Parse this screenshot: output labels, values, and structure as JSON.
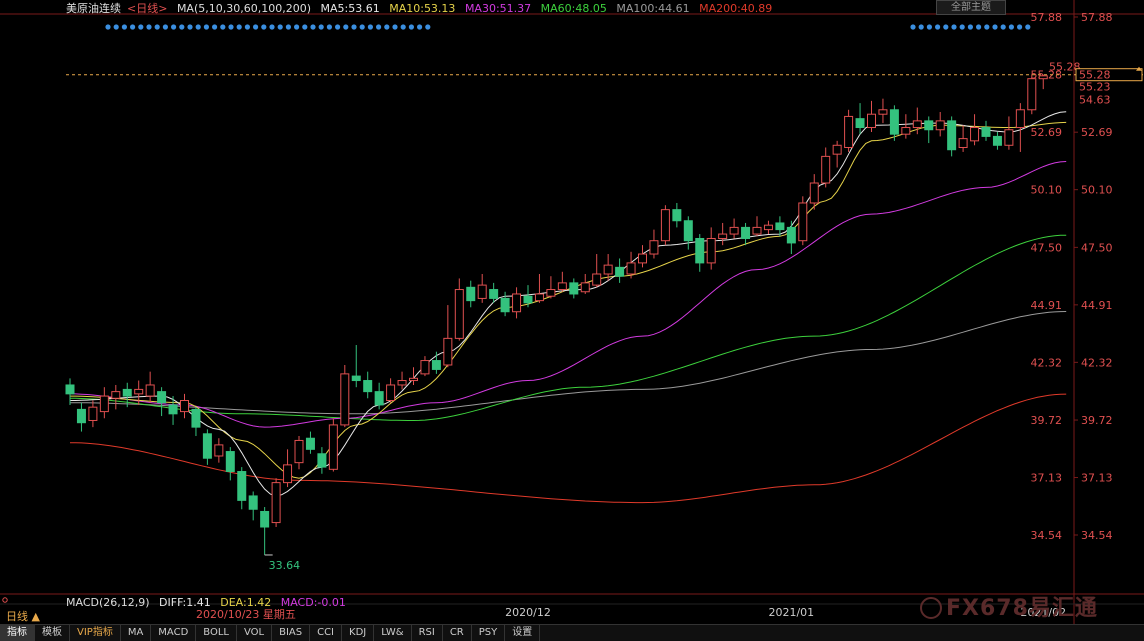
{
  "header": {
    "instrument": "美原油连续",
    "period_tag": "<日线>",
    "ma_params": "MA(5,10,30,60,100,200)",
    "ma5": "MA5:53.61",
    "ma10": "MA10:53.13",
    "ma30": "MA30:51.37",
    "ma60": "MA60:48.05",
    "ma100": "MA100:44.61",
    "ma200": "MA200:40.89",
    "theme_button": "全部主题"
  },
  "indicator": {
    "period_label": "日线 ▲",
    "macd_params": "MACD(26,12,9)",
    "diff": "DIFF:1.41",
    "dea": "DEA:1.42",
    "macd": "MACD:-0.01",
    "date_flag": "2020/10/23 星期五"
  },
  "watermark": "FX678易汇通",
  "toolbar": {
    "items": [
      "指标",
      "模板",
      "VIP指标",
      "MA",
      "MACD",
      "BOLL",
      "VOL",
      "BIAS",
      "CCI",
      "KDJ",
      "LW&",
      "RSI",
      "CR",
      "PSY",
      "设置"
    ]
  },
  "chart_data": {
    "type": "candlestick",
    "y_ticks": [
      "57.88",
      "55.28",
      "52.69",
      "50.10",
      "47.50",
      "44.91",
      "42.32",
      "39.72",
      "37.13",
      "34.54"
    ],
    "ylim": [
      32.0,
      59.0
    ],
    "x_ticks": [
      "2020/12",
      "2021/01",
      "2021/02"
    ],
    "annotations": {
      "high_label": "55.28",
      "low_label": "33.64",
      "price_box": [
        "55.28",
        "55.23",
        "54.63"
      ]
    },
    "colors": {
      "up": "#e05050",
      "down": "#34c27e",
      "ma5": "#e8e8e8",
      "ma10": "#e6d34a",
      "ma30": "#d23be0",
      "ma60": "#3dd13d",
      "ma100": "#9a9a9a",
      "ma200": "#e03a2a",
      "bg": "#000000",
      "axis": "#7a1a1a",
      "tick_text": "#e05050"
    },
    "candles": [
      [
        41.3,
        40.9,
        41.6,
        40.4
      ],
      [
        40.2,
        39.6,
        40.5,
        39.2
      ],
      [
        39.7,
        40.3,
        40.6,
        39.4
      ],
      [
        40.1,
        40.8,
        41.2,
        39.8
      ],
      [
        40.7,
        41.0,
        41.3,
        40.2
      ],
      [
        41.1,
        40.8,
        41.4,
        40.3
      ],
      [
        40.9,
        41.1,
        41.5,
        40.4
      ],
      [
        40.8,
        41.3,
        41.9,
        40.5
      ],
      [
        41.0,
        40.5,
        41.2,
        39.9
      ],
      [
        40.4,
        40.0,
        40.8,
        39.5
      ],
      [
        40.1,
        40.6,
        40.9,
        39.8
      ],
      [
        40.2,
        39.4,
        40.3,
        39.0
      ],
      [
        39.1,
        38.0,
        39.3,
        37.7
      ],
      [
        38.1,
        38.6,
        38.9,
        37.8
      ],
      [
        38.3,
        37.4,
        38.5,
        37.0
      ],
      [
        37.4,
        36.1,
        37.6,
        35.7
      ],
      [
        36.3,
        35.7,
        36.5,
        35.2
      ],
      [
        35.6,
        34.9,
        35.8,
        33.64
      ],
      [
        35.1,
        36.9,
        37.1,
        34.9
      ],
      [
        36.9,
        37.7,
        38.4,
        36.7
      ],
      [
        37.8,
        38.8,
        39.0,
        37.5
      ],
      [
        38.9,
        38.4,
        39.2,
        38.2
      ],
      [
        38.2,
        37.6,
        38.5,
        37.3
      ],
      [
        37.5,
        39.5,
        39.8,
        37.4
      ],
      [
        39.5,
        41.8,
        42.2,
        39.4
      ],
      [
        41.7,
        41.5,
        43.1,
        41.2
      ],
      [
        41.5,
        41.0,
        41.9,
        40.7
      ],
      [
        41.0,
        40.4,
        41.4,
        40.2
      ],
      [
        40.6,
        41.3,
        41.6,
        40.5
      ],
      [
        41.3,
        41.5,
        41.9,
        41.1
      ],
      [
        41.5,
        41.6,
        42.1,
        41.3
      ],
      [
        41.8,
        42.4,
        42.6,
        41.7
      ],
      [
        42.4,
        42.0,
        42.8,
        41.8
      ],
      [
        42.2,
        43.4,
        44.9,
        42.1
      ],
      [
        43.4,
        45.6,
        46.1,
        43.3
      ],
      [
        45.7,
        45.1,
        46.0,
        44.8
      ],
      [
        45.2,
        45.8,
        46.3,
        45.0
      ],
      [
        45.6,
        45.2,
        45.9,
        45.0
      ],
      [
        45.2,
        44.6,
        45.5,
        44.4
      ],
      [
        44.6,
        45.4,
        45.7,
        44.3
      ],
      [
        45.3,
        45.0,
        45.8,
        44.8
      ],
      [
        45.1,
        45.4,
        46.3,
        45.0
      ],
      [
        45.3,
        45.6,
        46.2,
        45.2
      ],
      [
        45.6,
        45.9,
        46.4,
        45.5
      ],
      [
        45.9,
        45.4,
        46.1,
        45.2
      ],
      [
        45.5,
        45.9,
        46.3,
        45.4
      ],
      [
        45.8,
        46.3,
        47.2,
        45.7
      ],
      [
        46.3,
        46.7,
        47.2,
        46.0
      ],
      [
        46.6,
        46.2,
        47.0,
        45.9
      ],
      [
        46.3,
        46.8,
        47.3,
        46.1
      ],
      [
        46.8,
        47.2,
        47.6,
        46.6
      ],
      [
        47.2,
        47.8,
        48.3,
        47.0
      ],
      [
        47.8,
        49.2,
        49.4,
        47.6
      ],
      [
        49.2,
        48.7,
        49.5,
        48.4
      ],
      [
        48.7,
        47.8,
        48.9,
        47.4
      ],
      [
        47.9,
        46.8,
        48.1,
        46.4
      ],
      [
        46.8,
        47.9,
        48.4,
        46.5
      ],
      [
        47.9,
        48.1,
        48.6,
        47.6
      ],
      [
        48.1,
        48.4,
        48.8,
        47.9
      ],
      [
        48.4,
        47.9,
        48.6,
        47.6
      ],
      [
        48.1,
        48.4,
        48.9,
        48.0
      ],
      [
        48.3,
        48.5,
        48.7,
        48.1
      ],
      [
        48.6,
        48.3,
        48.9,
        48.0
      ],
      [
        48.4,
        47.7,
        48.7,
        47.2
      ],
      [
        47.8,
        49.5,
        49.8,
        47.6
      ],
      [
        49.5,
        50.4,
        50.8,
        49.2
      ],
      [
        50.4,
        51.6,
        52.0,
        50.2
      ],
      [
        51.7,
        52.1,
        52.3,
        51.1
      ],
      [
        52.0,
        53.4,
        53.7,
        51.8
      ],
      [
        53.3,
        52.9,
        54.0,
        52.6
      ],
      [
        52.9,
        53.5,
        54.1,
        52.7
      ],
      [
        53.5,
        53.7,
        54.2,
        53.1
      ],
      [
        53.7,
        52.6,
        53.9,
        52.3
      ],
      [
        52.6,
        52.9,
        53.5,
        52.4
      ],
      [
        52.9,
        53.2,
        53.8,
        52.6
      ],
      [
        53.2,
        52.8,
        53.4,
        52.2
      ],
      [
        52.8,
        53.2,
        53.6,
        52.5
      ],
      [
        53.2,
        51.9,
        53.4,
        51.6
      ],
      [
        52.0,
        52.4,
        53.0,
        51.8
      ],
      [
        52.3,
        52.9,
        53.5,
        52.1
      ],
      [
        52.9,
        52.5,
        53.2,
        52.3
      ],
      [
        52.5,
        52.1,
        52.7,
        51.9
      ],
      [
        52.1,
        52.8,
        53.4,
        51.9
      ],
      [
        52.9,
        53.7,
        54.0,
        51.8
      ],
      [
        53.7,
        55.1,
        55.3,
        53.5
      ],
      [
        55.1,
        55.23,
        55.28,
        54.63
      ]
    ],
    "ma_lines": {
      "ma200": [
        [
          0,
          38.7
        ],
        [
          20,
          37.0
        ],
        [
          50,
          36.0
        ],
        [
          65,
          36.8
        ],
        [
          87,
          40.89
        ]
      ],
      "ma100": [
        [
          0,
          40.5
        ],
        [
          25,
          40.0
        ],
        [
          50,
          41.1
        ],
        [
          70,
          42.9
        ],
        [
          87,
          44.61
        ]
      ],
      "ma60": [
        [
          0,
          40.7
        ],
        [
          15,
          40.0
        ],
        [
          30,
          39.7
        ],
        [
          45,
          41.2
        ],
        [
          65,
          43.5
        ],
        [
          87,
          48.05
        ]
      ],
      "ma30": [
        [
          0,
          40.9
        ],
        [
          10,
          40.4
        ],
        [
          17,
          39.4
        ],
        [
          24,
          39.8
        ],
        [
          32,
          40.5
        ],
        [
          40,
          41.5
        ],
        [
          50,
          43.5
        ],
        [
          60,
          46.5
        ],
        [
          70,
          49.0
        ],
        [
          80,
          50.2
        ],
        [
          87,
          51.37
        ]
      ],
      "ma10": [
        [
          0,
          40.8
        ],
        [
          10,
          40.5
        ],
        [
          15,
          38.8
        ],
        [
          20,
          37.1
        ],
        [
          25,
          39.5
        ],
        [
          30,
          41.0
        ],
        [
          38,
          44.8
        ],
        [
          48,
          46.2
        ],
        [
          56,
          47.3
        ],
        [
          62,
          48.0
        ],
        [
          66,
          49.6
        ],
        [
          70,
          52.3
        ],
        [
          76,
          53.0
        ],
        [
          82,
          52.9
        ],
        [
          87,
          53.13
        ]
      ],
      "ma5": [
        [
          0,
          40.6
        ],
        [
          8,
          40.8
        ],
        [
          13,
          39.3
        ],
        [
          18,
          36.3
        ],
        [
          22,
          37.6
        ],
        [
          27,
          40.4
        ],
        [
          33,
          42.8
        ],
        [
          38,
          45.3
        ],
        [
          45,
          45.6
        ],
        [
          52,
          47.6
        ],
        [
          56,
          47.8
        ],
        [
          62,
          48.1
        ],
        [
          66,
          50.4
        ],
        [
          70,
          53.0
        ],
        [
          76,
          53.1
        ],
        [
          82,
          52.7
        ],
        [
          87,
          53.61
        ]
      ]
    }
  }
}
